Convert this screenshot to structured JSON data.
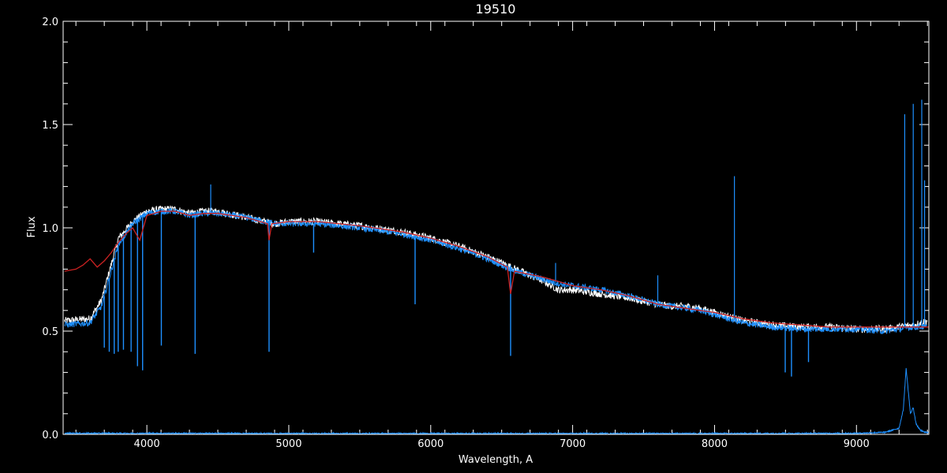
{
  "chart_data": {
    "type": "line",
    "title": "19510",
    "xlabel": "Wavelength, A",
    "ylabel": "Flux",
    "xlim": [
      3410,
      9510
    ],
    "ylim": [
      0.0,
      2.0
    ],
    "xticks": [
      4000,
      5000,
      6000,
      7000,
      8000,
      9000
    ],
    "yticks": [
      0.0,
      0.5,
      1.0,
      1.5,
      2.0
    ],
    "ytick_labels": [
      "0.0",
      "0.5",
      "1.0",
      "1.5",
      "2.0"
    ],
    "grid": false,
    "background": "#000000",
    "series": [
      {
        "role": "observed",
        "color": "#ffffff",
        "x": [
          3420,
          3600,
          3680,
          3800,
          3900,
          4000,
          4100,
          4200,
          4300,
          4400,
          4500,
          4700,
          4900,
          5000,
          5200,
          5500,
          5800,
          6000,
          6200,
          6400,
          6600,
          6800,
          6900,
          7000,
          7200,
          7400,
          7600,
          7700,
          7800,
          7900,
          8000,
          8100,
          8200,
          8400,
          8600,
          8800,
          9000,
          9200,
          9300,
          9400,
          9500
        ],
        "y": [
          0.55,
          0.56,
          0.65,
          0.95,
          1.03,
          1.08,
          1.09,
          1.09,
          1.07,
          1.08,
          1.08,
          1.05,
          1.02,
          1.03,
          1.03,
          1.01,
          0.98,
          0.95,
          0.91,
          0.86,
          0.8,
          0.74,
          0.7,
          0.7,
          0.68,
          0.66,
          0.63,
          0.62,
          0.62,
          0.61,
          0.59,
          0.57,
          0.55,
          0.53,
          0.52,
          0.52,
          0.51,
          0.51,
          0.52,
          0.53,
          0.55
        ]
      },
      {
        "role": "observed-overlay",
        "color": "#1e90ff",
        "x": [
          3420,
          3600,
          3680,
          3800,
          3900,
          4000,
          4100,
          4200,
          4300,
          4400,
          4500,
          4700,
          4900,
          5000,
          5200,
          5500,
          5800,
          6000,
          6200,
          6400,
          6600,
          6800,
          6900,
          7000,
          7200,
          7400,
          7600,
          7700,
          7800,
          7900,
          8000,
          8100,
          8200,
          8400,
          8600,
          8800,
          9000,
          9200,
          9300,
          9400,
          9500
        ],
        "y": [
          0.53,
          0.54,
          0.62,
          0.92,
          1.02,
          1.07,
          1.08,
          1.08,
          1.06,
          1.07,
          1.07,
          1.05,
          1.02,
          1.02,
          1.02,
          1.0,
          0.97,
          0.94,
          0.9,
          0.85,
          0.79,
          0.75,
          0.73,
          0.72,
          0.7,
          0.67,
          0.63,
          0.62,
          0.61,
          0.6,
          0.58,
          0.56,
          0.54,
          0.52,
          0.51,
          0.51,
          0.51,
          0.5,
          0.51,
          0.52,
          0.52
        ],
        "absorption_lines": [
          {
            "x": 3700,
            "y": 0.42
          },
          {
            "x": 3735,
            "y": 0.4
          },
          {
            "x": 3770,
            "y": 0.39
          },
          {
            "x": 3798,
            "y": 0.4
          },
          {
            "x": 3835,
            "y": 0.41
          },
          {
            "x": 3889,
            "y": 0.4
          },
          {
            "x": 3934,
            "y": 0.33
          },
          {
            "x": 3970,
            "y": 0.31
          },
          {
            "x": 4102,
            "y": 0.43
          },
          {
            "x": 4340,
            "y": 0.39
          },
          {
            "x": 4861,
            "y": 0.4
          },
          {
            "x": 5175,
            "y": 0.88
          },
          {
            "x": 5890,
            "y": 0.63
          },
          {
            "x": 6563,
            "y": 0.38
          },
          {
            "x": 8498,
            "y": 0.3
          },
          {
            "x": 8542,
            "y": 0.28
          },
          {
            "x": 8662,
            "y": 0.35
          }
        ],
        "emission_spikes": [
          {
            "x": 4450,
            "y": 1.21
          },
          {
            "x": 6880,
            "y": 0.83
          },
          {
            "x": 7600,
            "y": 0.77
          },
          {
            "x": 8140,
            "y": 1.25
          },
          {
            "x": 9340,
            "y": 1.55
          },
          {
            "x": 9400,
            "y": 1.6
          },
          {
            "x": 9460,
            "y": 1.62
          },
          {
            "x": 9480,
            "y": 1.23
          }
        ]
      },
      {
        "role": "model",
        "color": "#cc2222",
        "x": [
          3420,
          3500,
          3550,
          3600,
          3650,
          3700,
          3750,
          3800,
          3850,
          3900,
          3950,
          4000,
          4050,
          4100,
          4200,
          4300,
          4400,
          4500,
          4700,
          4850,
          4861,
          4880,
          5000,
          5200,
          5500,
          5800,
          6000,
          6200,
          6400,
          6540,
          6563,
          6590,
          6800,
          7000,
          7200,
          7400,
          7600,
          7800,
          8000,
          8200,
          8400,
          8600,
          8800,
          9000,
          9200,
          9400,
          9510
        ],
        "y": [
          0.79,
          0.8,
          0.82,
          0.85,
          0.81,
          0.84,
          0.88,
          0.93,
          0.97,
          1.0,
          0.94,
          1.06,
          1.07,
          1.08,
          1.08,
          1.06,
          1.07,
          1.07,
          1.05,
          1.02,
          0.94,
          1.02,
          1.03,
          1.03,
          1.01,
          0.98,
          0.95,
          0.91,
          0.86,
          0.81,
          0.68,
          0.79,
          0.76,
          0.72,
          0.7,
          0.67,
          0.63,
          0.61,
          0.59,
          0.56,
          0.54,
          0.53,
          0.52,
          0.52,
          0.52,
          0.52,
          0.52
        ]
      },
      {
        "role": "error",
        "color": "#1e90ff",
        "x": [
          3420,
          4000,
          5000,
          6000,
          7000,
          8000,
          9000,
          9200,
          9300,
          9330,
          9350,
          9380,
          9400,
          9420,
          9450,
          9480,
          9510
        ],
        "y": [
          0.005,
          0.005,
          0.004,
          0.004,
          0.004,
          0.004,
          0.005,
          0.01,
          0.03,
          0.12,
          0.32,
          0.1,
          0.13,
          0.05,
          0.02,
          0.01,
          0.01
        ]
      }
    ]
  }
}
